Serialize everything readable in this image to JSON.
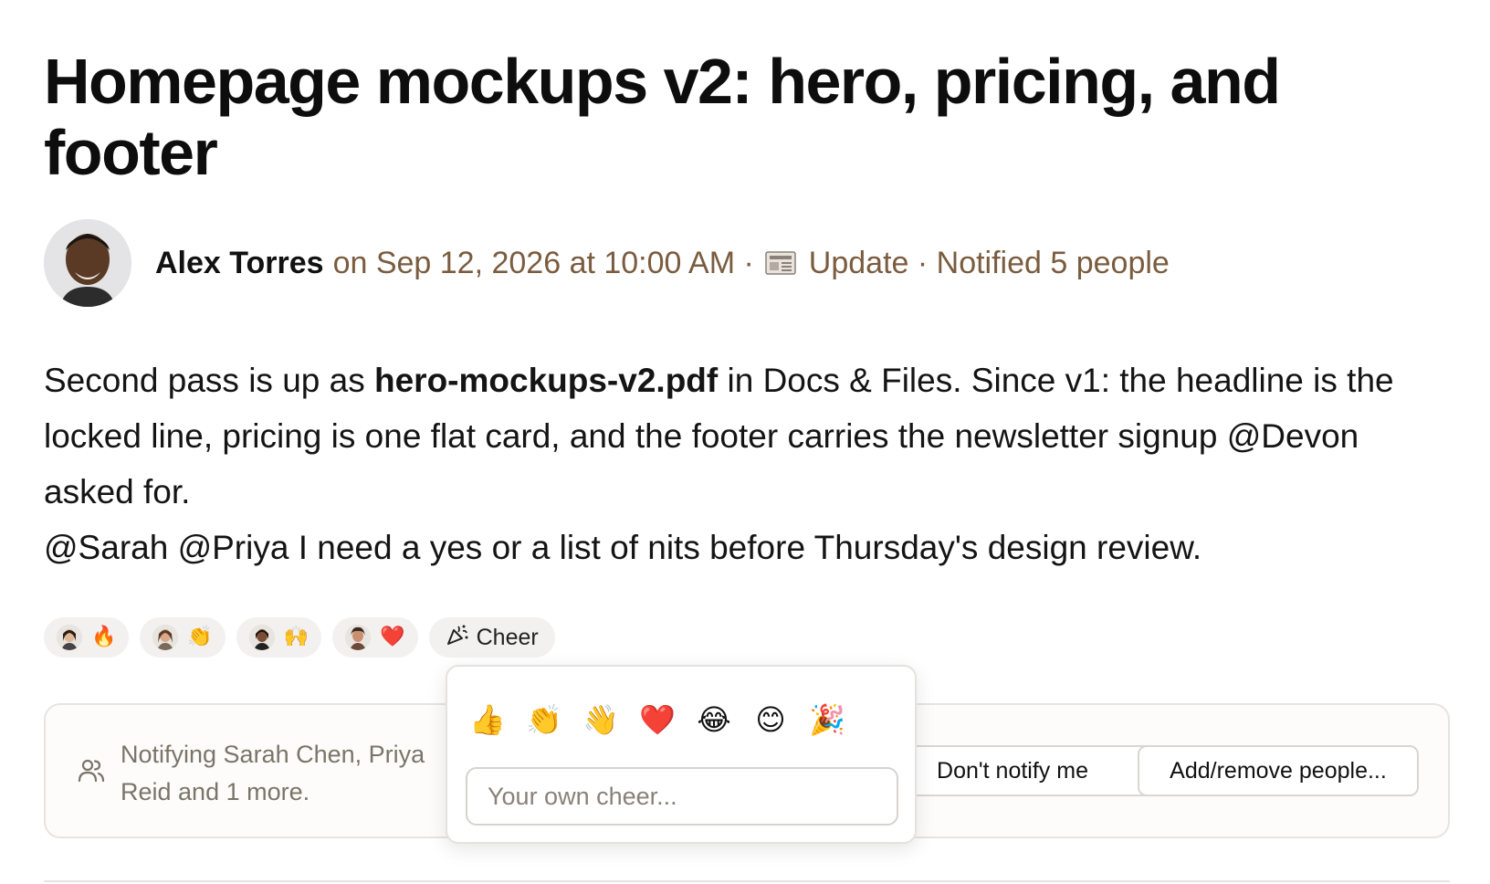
{
  "post": {
    "title": "Homepage mockups v2: hero, pricing, and footer",
    "author": "Alex Torres",
    "meta_date": "on Sep 12, 2026 at 10:00 AM ·",
    "meta_type": "Update · Notified 5 people",
    "body": {
      "line1_pre": "Second pass is up as ",
      "line1_file": "hero-mockups-v2.pdf",
      "line1_post": " in Docs & Files. Since v1: the headline is the locked line, pricing is one flat card, and the footer carries the newsletter signup @Devon asked for.",
      "line2": "@Sarah @Priya I need a yes or a list of nits before Thursday's design review."
    }
  },
  "reactions": [
    {
      "emoji": "🔥",
      "icon": "fire-emoji"
    },
    {
      "emoji": "👏",
      "icon": "clap-emoji"
    },
    {
      "emoji": "🙌",
      "icon": "raised-hands-emoji"
    },
    {
      "emoji": "❤️",
      "icon": "heart-emoji"
    }
  ],
  "cheer_button": {
    "label": "Cheer",
    "icon": "party-popper-icon"
  },
  "notify": {
    "text": "Notifying Sarah Chen, Priya Reid and 1 more.",
    "dont_notify_label": "Don't notify me",
    "add_remove_label": "Add/remove people..."
  },
  "cheer_popover": {
    "emojis": [
      "👍",
      "👏",
      "👋",
      "❤️",
      "😂",
      "😊",
      "🎉"
    ],
    "input_placeholder": "Your own cheer..."
  },
  "colors": {
    "meta_brown": "#7a5c3f",
    "muted_text": "#7b7468",
    "chip_bg": "#f3f1ef"
  }
}
